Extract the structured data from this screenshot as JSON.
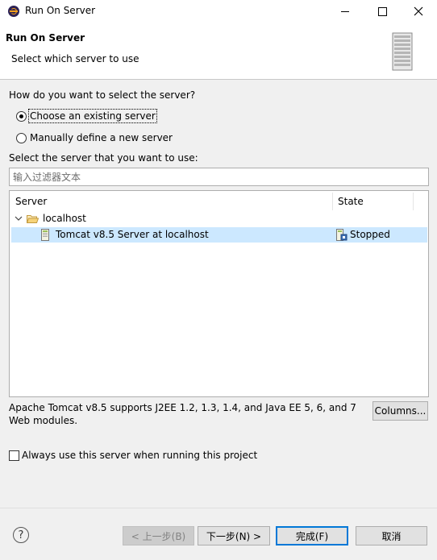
{
  "window": {
    "title": "Run On Server"
  },
  "header": {
    "title": "Run On Server",
    "description": "Select which server to use"
  },
  "selection": {
    "question": "How do you want to select the server?",
    "options": [
      {
        "label": "Choose an existing server",
        "checked": true
      },
      {
        "label": "Manually define a new server",
        "checked": false
      }
    ],
    "list_label": "Select the server that you want to use:",
    "filter_placeholder": "输入过滤器文本"
  },
  "server_table": {
    "columns": [
      "Server",
      "State"
    ],
    "groups": [
      {
        "label": "localhost",
        "expanded": true,
        "servers": [
          {
            "name": "Tomcat v8.5 Server at localhost",
            "state": "Stopped",
            "selected": true
          }
        ]
      }
    ]
  },
  "details": {
    "description": "Apache Tomcat v8.5 supports J2EE 1.2, 1.3, 1.4, and Java EE 5, 6, and 7 Web modules.",
    "columns_button": "Columns..."
  },
  "always_use": {
    "label": "Always use this server when running this project",
    "checked": false
  },
  "footer": {
    "back": "< 上一步(B)",
    "next": "下一步(N) >",
    "finish": "完成(F)",
    "cancel": "取消"
  },
  "colors": {
    "selection_bg": "#cce8ff",
    "default_button_border": "#0078d7"
  }
}
